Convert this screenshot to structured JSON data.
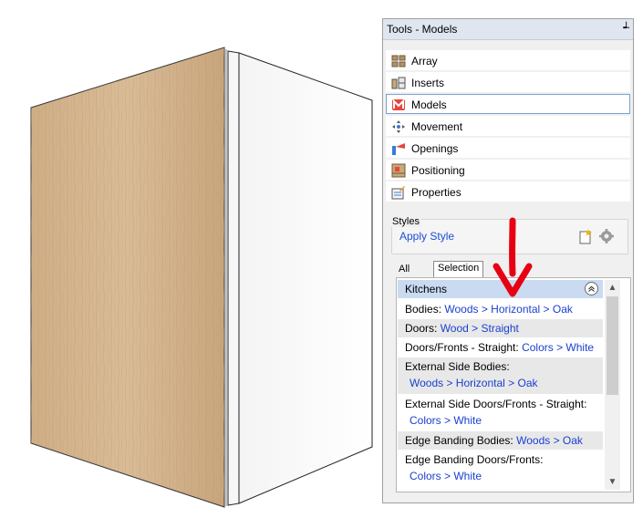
{
  "panel": {
    "title": "Tools - Models",
    "pin_glyph": "┵"
  },
  "tools": [
    {
      "label": "Array",
      "icon": "array-icon"
    },
    {
      "label": "Inserts",
      "icon": "inserts-icon"
    },
    {
      "label": "Models",
      "icon": "models-icon",
      "selected": true
    },
    {
      "label": "Movement",
      "icon": "movement-icon"
    },
    {
      "label": "Openings",
      "icon": "openings-icon"
    },
    {
      "label": "Positioning",
      "icon": "positioning-icon"
    },
    {
      "label": "Properties",
      "icon": "properties-icon"
    }
  ],
  "styles": {
    "legend": "Styles",
    "apply_label": "Apply Style"
  },
  "tabs": {
    "all": "All",
    "selection": "Selection"
  },
  "list": {
    "header": "Kitchens",
    "rows": [
      {
        "key": "Bodies:",
        "value": "Woods > Horizontal > Oak"
      },
      {
        "key": "Doors:",
        "value": "Wood > Straight"
      },
      {
        "key": "Doors/Fronts - Straight:",
        "value": "Colors > White"
      },
      {
        "key": "External Side Bodies:",
        "value": "Woods > Horizontal > Oak"
      },
      {
        "key": "External Side Doors/Fronts - Straight:",
        "value": "Colors > White"
      },
      {
        "key": "Edge Banding Bodies:",
        "value": "Woods > Oak"
      },
      {
        "key": "Edge Banding Doors/Fronts:",
        "value": "Colors > White"
      }
    ]
  },
  "colors": {
    "link": "#1a3fd0",
    "header_bg": "#c9daf1",
    "arrow": "#e60012",
    "oak": "#d2b48c"
  }
}
